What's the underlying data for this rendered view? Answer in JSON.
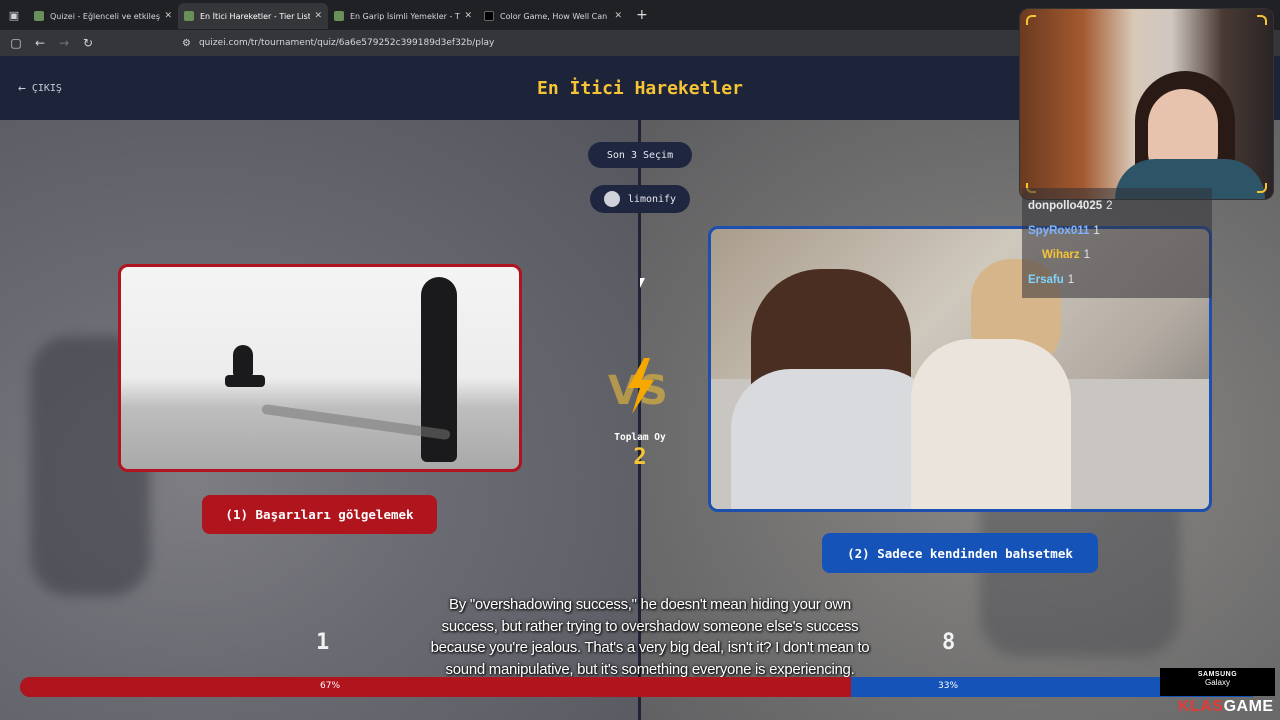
{
  "browser": {
    "tabs": [
      {
        "title": "Quizei - Eğlenceli ve etkileşimli",
        "active": false
      },
      {
        "title": "En İtici Hareketler - Tier List, Kö",
        "active": true
      },
      {
        "title": "En Garip İsimli Yemekler - Tier L",
        "active": false
      },
      {
        "title": "Color Game, How Well Can You",
        "active": false
      }
    ],
    "url": "quizei.com/tr/tournament/quiz/6a6e579252c399189d3ef32b/play"
  },
  "header": {
    "exit_label": "ÇIKIŞ",
    "title": "En İtici Hareketler"
  },
  "last_choices_label": "Son 3 Seçim",
  "user_label": "limonify",
  "choices": {
    "left": {
      "label": "(1) Başarıları gölgelemek",
      "votes": "1",
      "percent": "67%",
      "share": 0.67,
      "color": "#b0141d"
    },
    "right": {
      "label": "(2) Sadece kendinden bahsetmek",
      "votes": "8",
      "percent": "33%",
      "share": 0.33,
      "color": "#1553b8"
    }
  },
  "vs_label": "VS",
  "total": {
    "label": "Toplam Oy",
    "value": "2"
  },
  "subtitle": "By \"overshadowing success,\" he doesn't mean hiding your own success, but rather trying to overshadow someone else's success because you're jealous. That's a very big deal, isn't it? I don't mean to sound manipulative, but it's something everyone is experiencing.",
  "chat": [
    {
      "name": "donpollo4025",
      "value": "2",
      "color": "#e8e8e8"
    },
    {
      "name": "SpyRox011",
      "value": "1",
      "color": "#7fb2ff"
    },
    {
      "name": "Wiharz",
      "value": "1",
      "color": "#f6c435"
    },
    {
      "name": "Ersafu",
      "value": "1",
      "color": "#7fd3ff"
    }
  ],
  "sponsor": {
    "line1": "SAMSUNG",
    "line2": "Galaxy"
  },
  "brand": {
    "part1": "KLAS",
    "part2": "GAME"
  }
}
